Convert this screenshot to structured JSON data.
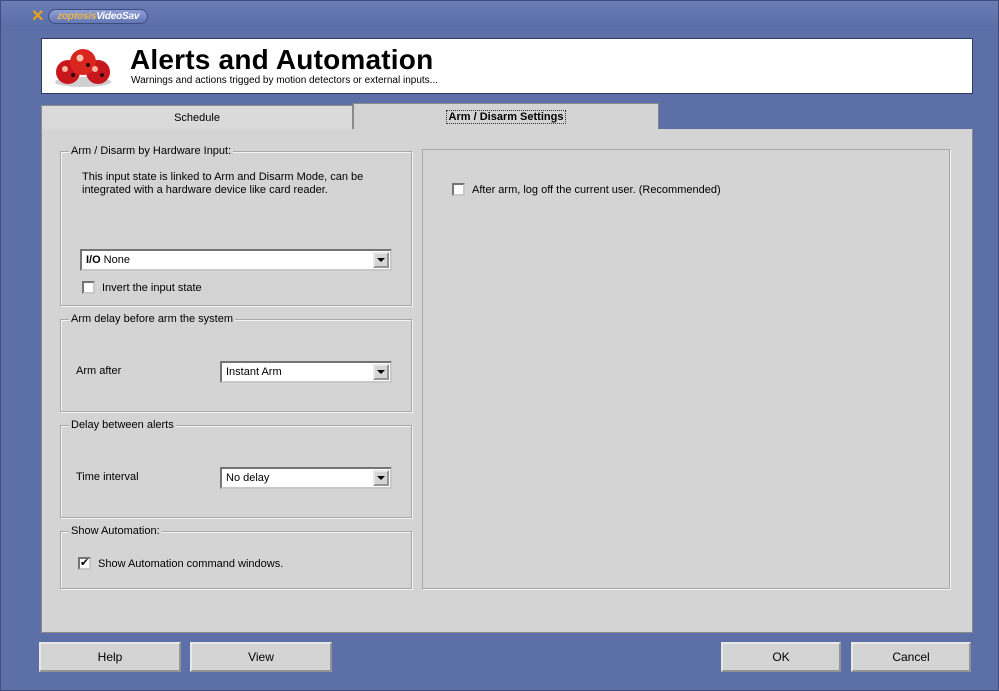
{
  "app": {
    "brand_part1": "zoptosis",
    "brand_part2": "VideoSav"
  },
  "header": {
    "title": "Alerts and Automation",
    "subtitle": "Warnings and actions trigged by motion detectors or external inputs..."
  },
  "tabs": [
    {
      "label": "Schedule",
      "active": false
    },
    {
      "label": "Arm / Disarm Settings",
      "active": true
    }
  ],
  "hardware_input": {
    "legend": "Arm / Disarm by Hardware Input:",
    "description": "This input state is linked to Arm and Disarm Mode, can be integrated with a hardware device like card reader.",
    "combo_prefix": "I/O",
    "combo_value": "None",
    "invert_label": "Invert the input state",
    "invert_checked": false
  },
  "arm_delay": {
    "legend": "Arm delay before arm the system",
    "label": "Arm after",
    "value": "Instant Arm"
  },
  "alert_delay": {
    "legend": "Delay between alerts",
    "label": "Time interval",
    "value": "No delay"
  },
  "automation": {
    "legend": "Show Automation:",
    "checkbox_label": "Show Automation command windows.",
    "checked": true
  },
  "right_panel": {
    "logoff_label": "After arm, log off the current user. (Recommended)",
    "logoff_checked": false
  },
  "buttons": {
    "help": "Help",
    "view": "View",
    "ok": "OK",
    "cancel": "Cancel"
  },
  "colors": {
    "frame": "#5d6fa7",
    "panel": "#d4d4d4",
    "header_bg": "#ffffff",
    "logo_red": "#c8161d"
  }
}
